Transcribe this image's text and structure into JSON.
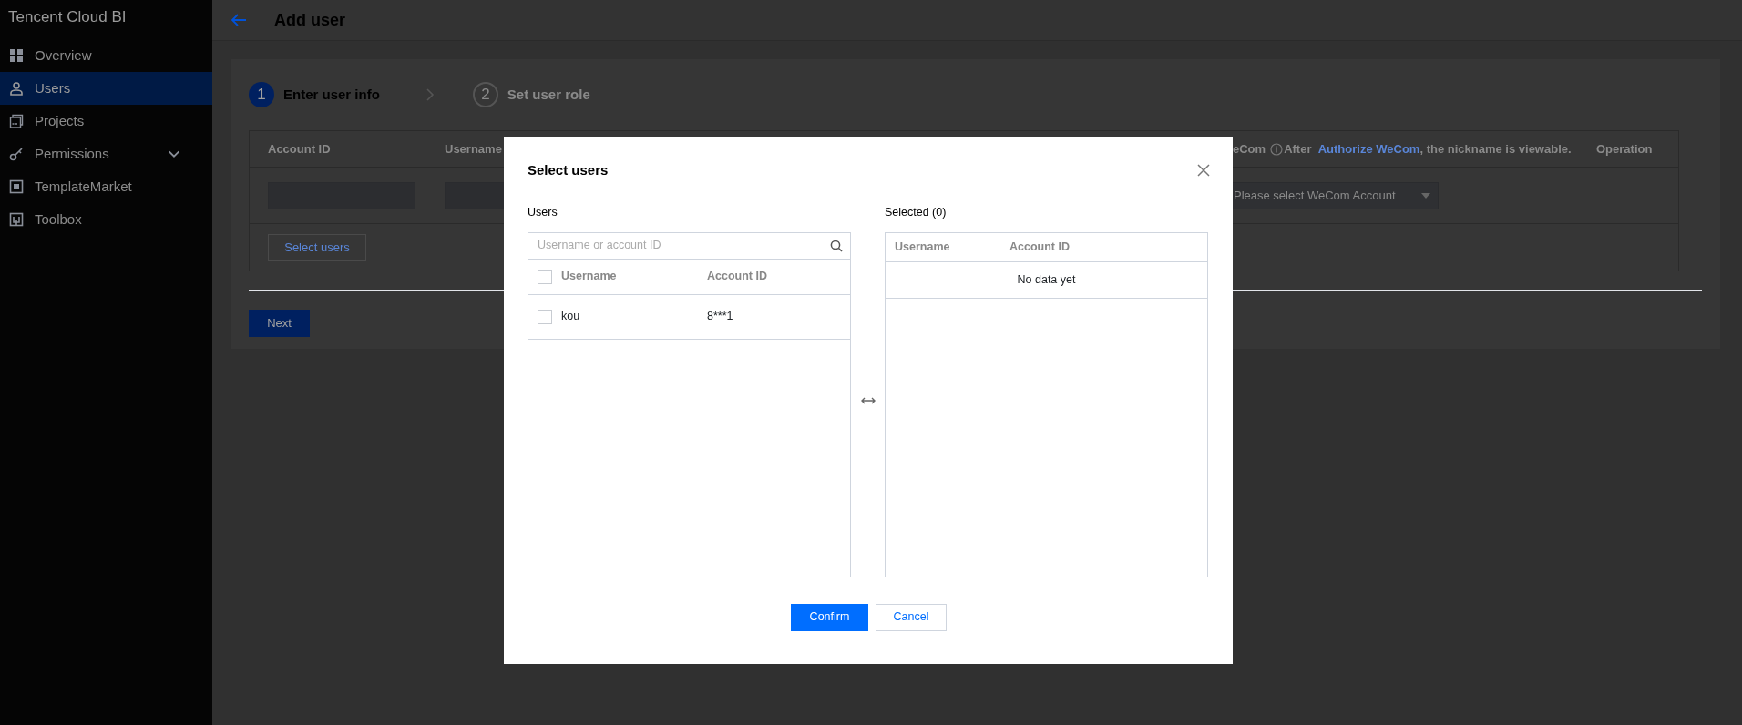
{
  "sidebar": {
    "title": "Tencent Cloud BI",
    "items": [
      {
        "label": "Overview",
        "kind": "grid",
        "selected": false
      },
      {
        "label": "Users",
        "kind": "person",
        "selected": true
      },
      {
        "label": "Projects",
        "kind": "projects",
        "selected": false
      },
      {
        "label": "Permissions",
        "kind": "key",
        "selected": false,
        "expanded": false
      },
      {
        "label": "TemplateMarket",
        "kind": "template",
        "selected": false
      },
      {
        "label": "Toolbox",
        "kind": "toolbox",
        "selected": false
      }
    ]
  },
  "header": {
    "title": "Add user"
  },
  "steps": [
    {
      "number": "1",
      "label": "Enter user info",
      "selected": true
    },
    {
      "number": "2",
      "label": "Set user role",
      "selected": false
    }
  ],
  "table": {
    "columns": [
      {
        "label": "Account ID"
      },
      {
        "label": "Username"
      },
      {
        "label": "eCom",
        "note": "After",
        "link": "Authorize WeCom",
        "note_end": ", the nickname is viewable."
      },
      {
        "label": "Operation"
      }
    ],
    "select_placeholder": "Please select WeCom Account"
  },
  "select_users_button": "Select users",
  "next_button": "Next",
  "modal": {
    "title": "Select users",
    "source": {
      "label": "Users",
      "search_placeholder": "Username or account ID",
      "columns": [
        "Username",
        "Account ID"
      ],
      "select_all_checked": false,
      "rows": [
        {
          "username": "kou",
          "account_id": "8***1",
          "checked": false
        }
      ]
    },
    "target": {
      "label": "Selected (0)",
      "columns": [
        "Username",
        "Account ID"
      ],
      "empty_text": "No data yet"
    },
    "buttons": [
      {
        "label": "Confirm",
        "kind": "primary"
      },
      {
        "label": "Cancel",
        "kind": "secondary"
      }
    ]
  }
}
